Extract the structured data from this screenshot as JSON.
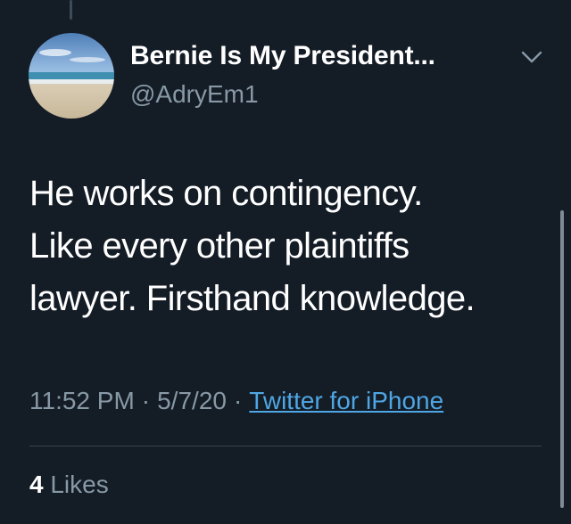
{
  "author": {
    "display_name": "Bernie Is My President...",
    "handle": "@AdryEm1",
    "avatar_icon": "beach-photo-avatar"
  },
  "tweet": {
    "lines": [
      "He works on contingency.",
      "Like every other plaintiffs",
      "lawyer. Firsthand knowledge."
    ],
    "time": "11:52 PM",
    "date": "5/7/20",
    "separator": "·",
    "source": "Twitter for iPhone"
  },
  "stats": {
    "likes_count": "4",
    "likes_label": "Likes"
  },
  "icons": {
    "menu": "chevron-down-icon"
  },
  "colors": {
    "background": "#141c26",
    "secondary_text": "#8899a6",
    "link": "#4fa6e4",
    "divider": "#38444d"
  }
}
